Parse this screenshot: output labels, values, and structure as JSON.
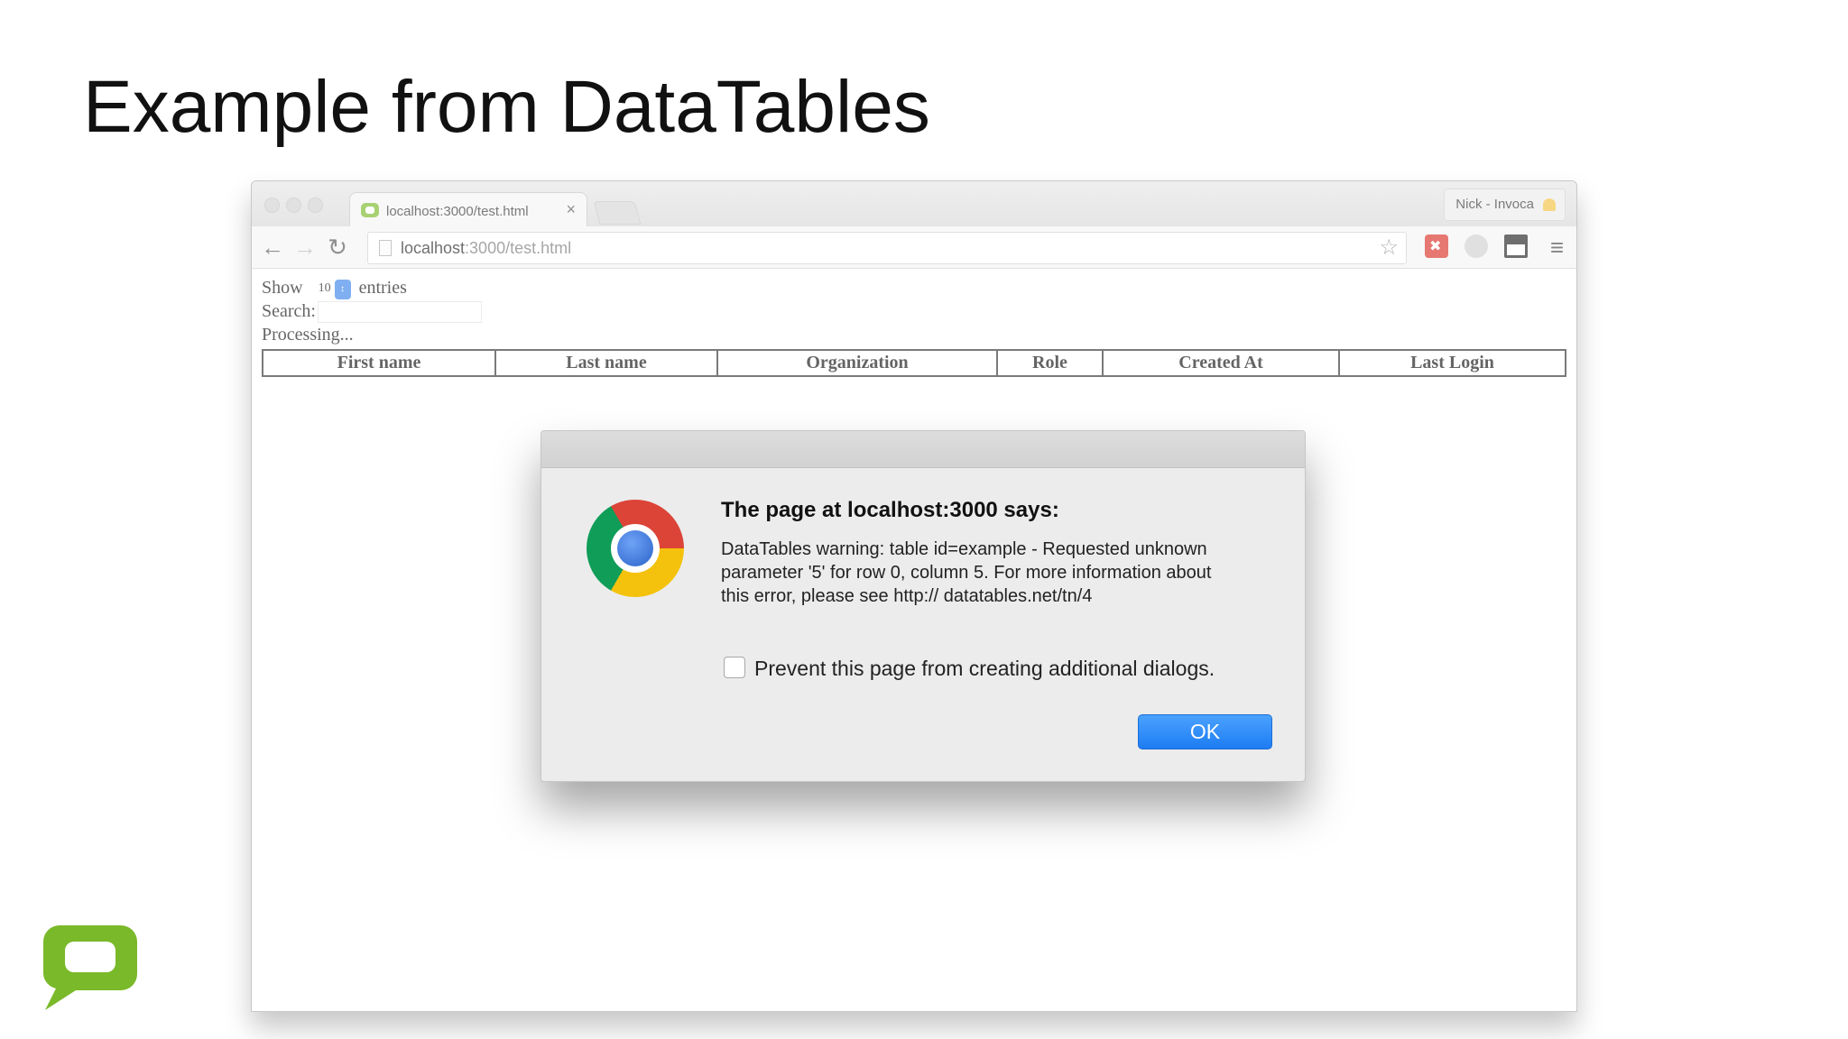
{
  "slide": {
    "title": "Example from DataTables"
  },
  "browser": {
    "tab_title": "localhost:3000/test.html",
    "tab_close": "×",
    "profile_name": "Nick - Invoca",
    "url_host": "localhost",
    "url_rest": ":3000/test.html"
  },
  "page": {
    "show_label": "Show",
    "length_value": "10",
    "entries_label": "entries",
    "search_label": "Search:",
    "processing_text": "Processing...",
    "columns": [
      "First name",
      "Last name",
      "Organization",
      "Role",
      "Created At",
      "Last Login"
    ]
  },
  "dialog": {
    "title": "The page at localhost:3000 says:",
    "message": "DataTables warning: table id=example - Requested unknown parameter '5' for row 0, column 5. For more information about this error, please see http:// datatables.net/tn/4",
    "checkbox_label": "Prevent this page from creating additional dialogs.",
    "ok_label": "OK"
  },
  "colors": {
    "ok_button": "#2a86f5",
    "brand_green": "#7ab929",
    "extension_red": "#d93025"
  },
  "icons": [
    "back-arrow-icon",
    "forward-arrow-icon",
    "reload-icon",
    "page-icon",
    "star-icon",
    "chrome-logo-icon",
    "brand-chat-logo-icon"
  ]
}
